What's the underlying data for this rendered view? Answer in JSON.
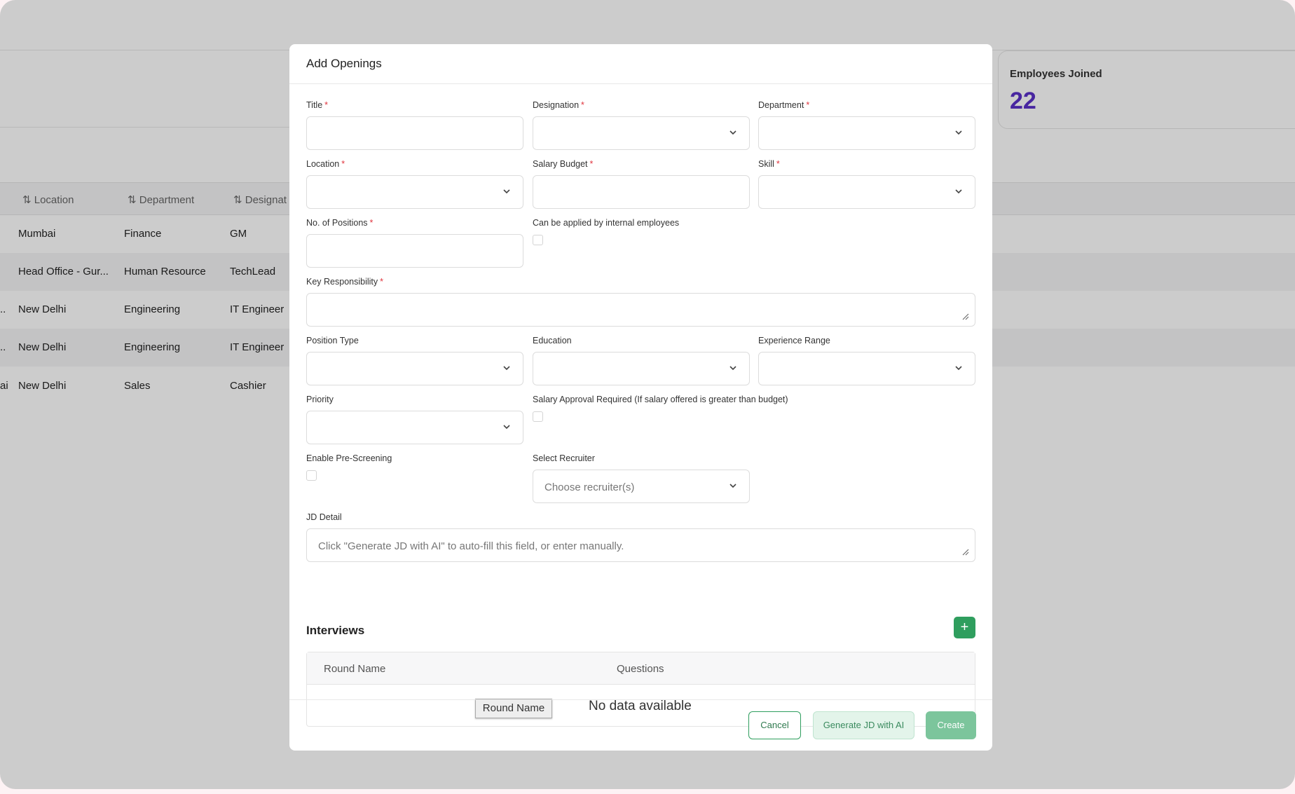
{
  "background": {
    "stat_card": {
      "label": "Employees Joined",
      "value": "22"
    },
    "table": {
      "headers": [
        {
          "label": "Location"
        },
        {
          "label": "Department"
        },
        {
          "label": "Designat"
        }
      ],
      "rows": [
        {
          "lead": "",
          "location": "Mumbai",
          "department": "Finance",
          "designation": "GM"
        },
        {
          "lead": "",
          "location": "Head Office - Gur...",
          "department": "Human Resource",
          "designation": "TechLead"
        },
        {
          "lead": "..",
          "location": "New Delhi",
          "department": "Engineering",
          "designation": "IT Engineer"
        },
        {
          "lead": "..",
          "location": "New Delhi",
          "department": "Engineering",
          "designation": "IT Engineer"
        },
        {
          "lead": "ai",
          "location": "New Delhi",
          "department": "Sales",
          "designation": "Cashier"
        }
      ]
    }
  },
  "modal": {
    "title": "Add Openings",
    "fields": {
      "title": {
        "label": "Title",
        "required_mark": "*"
      },
      "designation": {
        "label": "Designation",
        "required_mark": "*"
      },
      "department": {
        "label": "Department",
        "required_mark": "*"
      },
      "location": {
        "label": "Location",
        "required_mark": "*"
      },
      "salary_budget": {
        "label": "Salary Budget",
        "required_mark": "*"
      },
      "skill": {
        "label": "Skill",
        "required_mark": "*"
      },
      "positions": {
        "label": "No. of Positions",
        "required_mark": "*"
      },
      "internal": {
        "label": "Can be applied by internal employees"
      },
      "key_responsibility": {
        "label": "Key Responsibility",
        "required_mark": "*"
      },
      "position_type": {
        "label": "Position Type"
      },
      "education": {
        "label": "Education"
      },
      "experience_range": {
        "label": "Experience Range"
      },
      "priority": {
        "label": "Priority"
      },
      "salary_approval": {
        "label": "Salary Approval Required (If salary offered is greater than budget)"
      },
      "pre_screening": {
        "label": "Enable Pre-Screening"
      },
      "recruiter": {
        "label": "Select Recruiter",
        "placeholder": "Choose recruiter(s)"
      },
      "jd_detail": {
        "label": "JD Detail",
        "placeholder": "Click \"Generate JD with AI\" to auto-fill this field, or enter manually."
      }
    },
    "interviews": {
      "title": "Interviews",
      "add_label": "+",
      "columns": [
        "Round Name",
        "Questions"
      ],
      "empty_text": "No data available",
      "tooltip": "Round Name"
    },
    "footer": {
      "cancel": "Cancel",
      "generate": "Generate JD with AI",
      "create": "Create"
    }
  },
  "colors": {
    "accent_green": "#2f9e5e",
    "stat_purple": "#5a30c8",
    "required_red": "#e0353e"
  }
}
